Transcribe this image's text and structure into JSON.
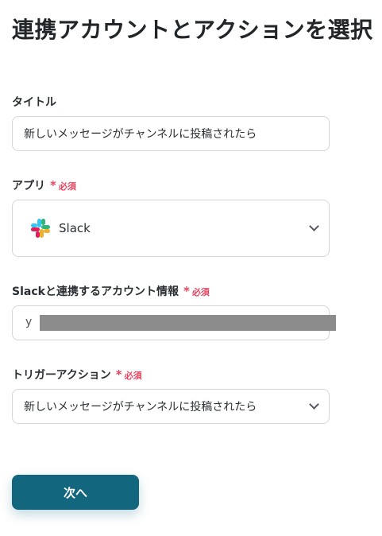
{
  "page": {
    "title": "連携アカウントとアクションを選択"
  },
  "fields": {
    "title_field": {
      "label": "タイトル",
      "value": "新しいメッセージがチャンネルに投稿されたら"
    },
    "app_field": {
      "label": "アプリ",
      "required_text": "必須",
      "selected": "Slack",
      "icon": "slack-logo"
    },
    "account_field": {
      "label": "Slackと連携するアカウント情報",
      "required_text": "必須",
      "visible_prefix": "y"
    },
    "trigger_field": {
      "label": "トリガーアクション",
      "required_text": "必須",
      "selected": "新しいメッセージがチャンネルに投稿されたら"
    }
  },
  "actions": {
    "next_label": "次へ"
  },
  "colors": {
    "required": "#e7445d",
    "primary_button": "#12677e",
    "border": "#d3d7db"
  }
}
